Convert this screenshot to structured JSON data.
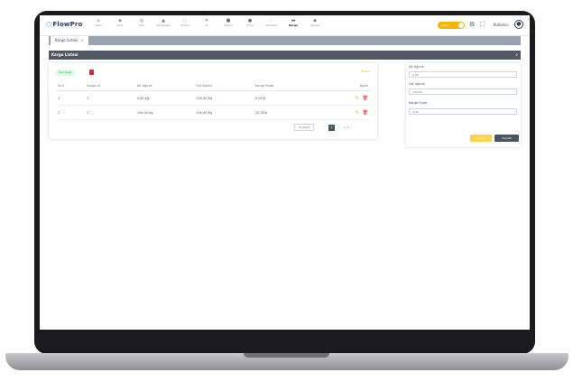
{
  "app": {
    "logo_text": "FlowPro",
    "logo_icon": "hexagon-icon"
  },
  "nav": {
    "items": [
      {
        "label": "Satış",
        "icon": "cart-icon"
      },
      {
        "label": "Stok",
        "icon": "box-icon"
      },
      {
        "label": "Cari",
        "icon": "user-icon"
      },
      {
        "label": "Muhasebe",
        "icon": "calc-icon"
      },
      {
        "label": "Finans",
        "icon": "money-icon"
      },
      {
        "label": "İK",
        "icon": "people-icon"
      },
      {
        "label": "Üretim",
        "icon": "factory-icon"
      },
      {
        "label": "Proje",
        "icon": "folder-icon"
      },
      {
        "label": "Tanımlar",
        "icon": "list-icon"
      },
      {
        "label": "Kargo",
        "icon": "truck-icon"
      },
      {
        "label": "Ayarlar",
        "icon": "settings-icon"
      }
    ]
  },
  "header": {
    "toggle_label": "Demo",
    "username": "Kullanıcı"
  },
  "tabs": [
    {
      "label": "Kargo Listesi"
    }
  ],
  "section": {
    "title": "Kargo Listesi"
  },
  "toolbar": {
    "new_label": "Yeni Kayıt",
    "filter_label": "Filtrele"
  },
  "table": {
    "columns": [
      "Sıra",
      "Kargo Id",
      "Alt Ağırlık",
      "Üst Ağırlık",
      "Kargo Fiyatı",
      "İşlem"
    ],
    "rows": [
      [
        "1",
        "1",
        "0,00 Kg",
        "100,00 Kg",
        "0,00 ₺"
      ],
      [
        "2",
        "2",
        "100,00 Kg",
        "200,00 Kg",
        "20,00 ₺"
      ]
    ]
  },
  "pager": {
    "page_size": "10 kayıt",
    "current": "1",
    "total_label": "1 / 1"
  },
  "form": {
    "fields": [
      {
        "label": "Alt Ağırlık",
        "value": "0,00"
      },
      {
        "label": "Üst Ağırlık",
        "value": "100,00"
      },
      {
        "label": "Kargo Fiyatı",
        "value": "0,00"
      }
    ],
    "cancel_label": "Vazgeç",
    "save_label": "Kaydet"
  },
  "colors": {
    "accent": "#f5b400",
    "dark": "#525861",
    "danger": "#dc2626",
    "success": "#16a34a"
  }
}
